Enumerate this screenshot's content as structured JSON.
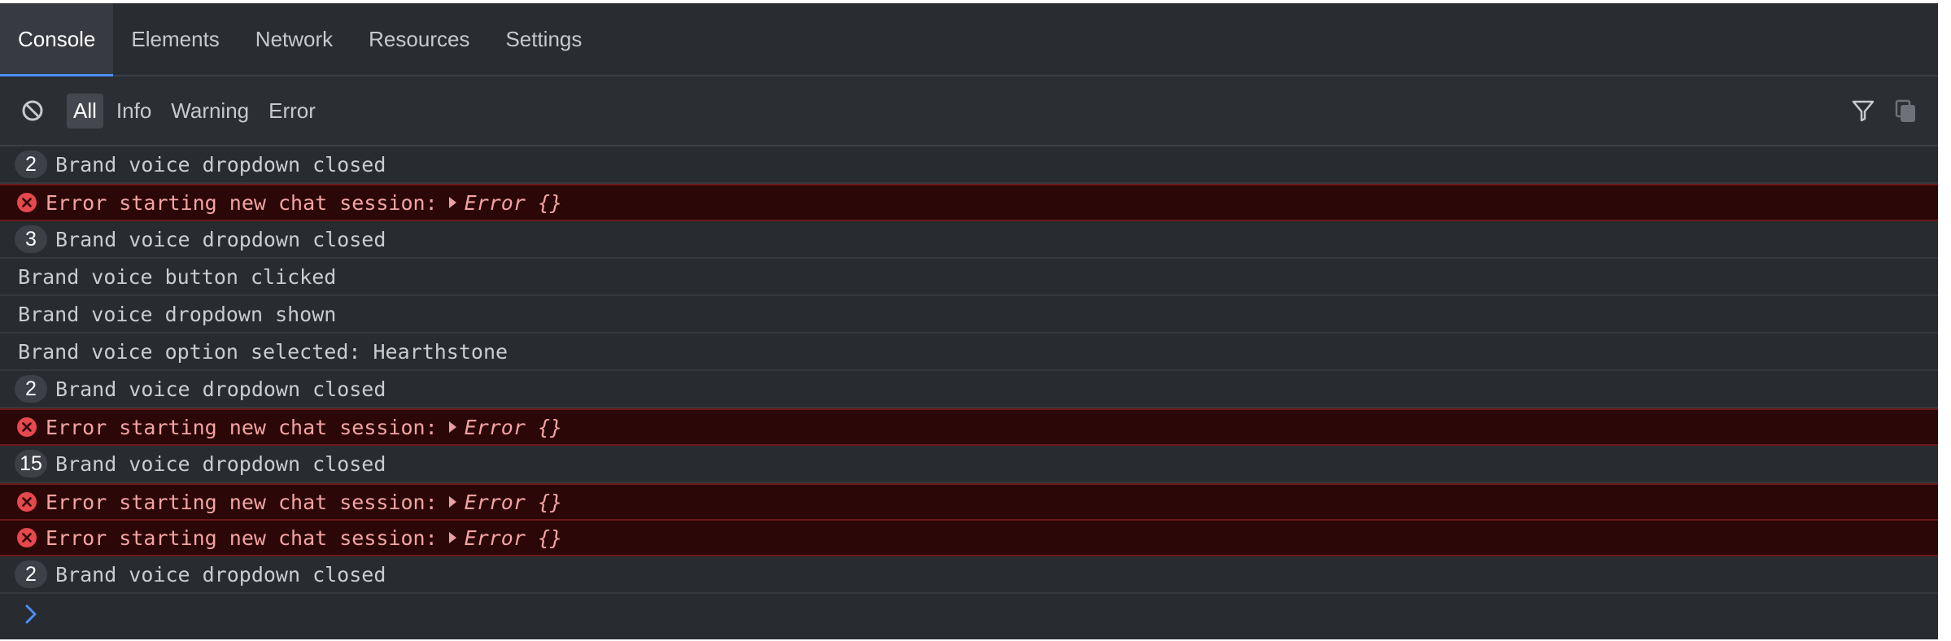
{
  "tabs": [
    {
      "label": "Console",
      "active": true
    },
    {
      "label": "Elements",
      "active": false
    },
    {
      "label": "Network",
      "active": false
    },
    {
      "label": "Resources",
      "active": false
    },
    {
      "label": "Settings",
      "active": false
    }
  ],
  "toolbar": {
    "clear_icon": "clear-console-icon",
    "filters": [
      {
        "label": "All",
        "active": true
      },
      {
        "label": "Info",
        "active": false
      },
      {
        "label": "Warning",
        "active": false
      },
      {
        "label": "Error",
        "active": false
      }
    ],
    "right_icons": [
      "filter-icon",
      "copy-icon"
    ]
  },
  "log": [
    {
      "type": "info",
      "count": "2",
      "message": "Brand voice dropdown closed"
    },
    {
      "type": "error",
      "message": "Error starting new chat session:",
      "object": "Error {}"
    },
    {
      "type": "info",
      "count": "3",
      "message": "Brand voice dropdown closed"
    },
    {
      "type": "info",
      "message": "Brand voice button clicked"
    },
    {
      "type": "info",
      "message": "Brand voice dropdown shown"
    },
    {
      "type": "info",
      "message": "Brand voice option selected: Hearthstone"
    },
    {
      "type": "info",
      "count": "2",
      "message": "Brand voice dropdown closed"
    },
    {
      "type": "error",
      "message": "Error starting new chat session:",
      "object": "Error {}"
    },
    {
      "type": "info",
      "count": "15",
      "message": "Brand voice dropdown closed"
    },
    {
      "type": "error",
      "message": "Error starting new chat session:",
      "object": "Error {}"
    },
    {
      "type": "error",
      "message": "Error starting new chat session:",
      "object": "Error {}"
    },
    {
      "type": "info",
      "count": "2",
      "message": "Brand voice dropdown closed"
    }
  ],
  "colors": {
    "panel_bg": "#282b30",
    "accent": "#4c8df6",
    "error_bg": "#2b0707",
    "error_text": "#f4a3a3",
    "error_icon": "#e5484d"
  }
}
